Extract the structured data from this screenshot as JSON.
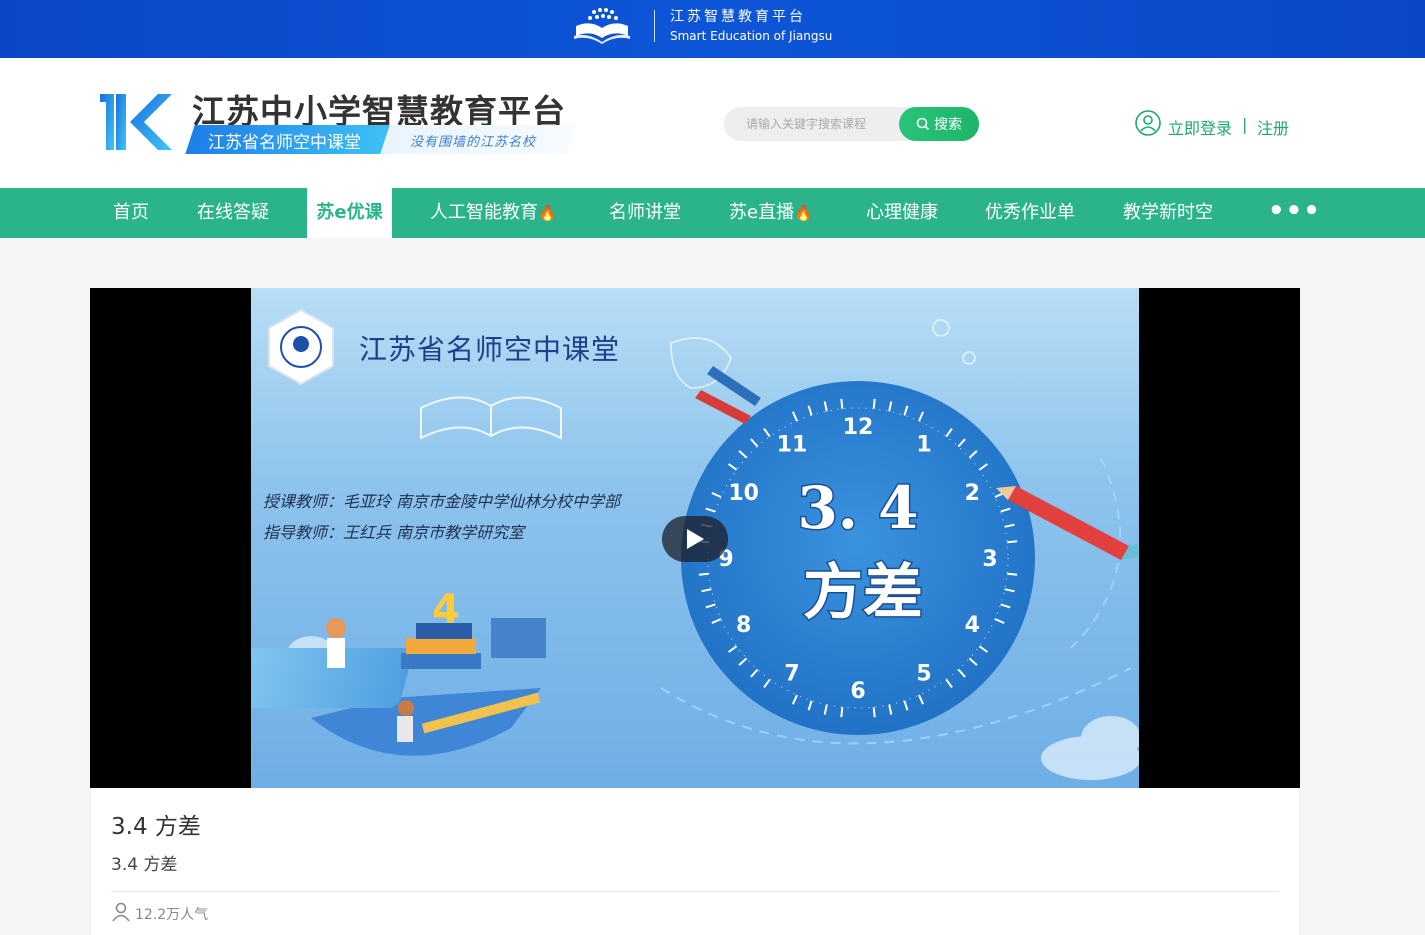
{
  "topbar": {
    "title_cn": "江苏智慧教育平台",
    "title_en": "Smart Education of Jiangsu"
  },
  "header": {
    "brand_title": "江苏中小学智慧教育平台",
    "brand_tag": "江苏省名师空中课堂",
    "brand_slogan": "没有围墙的江苏名校",
    "search_placeholder": "请输入关键字搜索课程",
    "search_button": "搜索",
    "login": "立即登录",
    "separator": "|",
    "register": "注册"
  },
  "nav": {
    "items": [
      {
        "label": "首页"
      },
      {
        "label": "在线答疑"
      },
      {
        "label": "苏e优课"
      },
      {
        "label": "人工智能教育"
      },
      {
        "label": "名师讲堂"
      },
      {
        "label": "苏e直播"
      },
      {
        "label": "心理健康"
      },
      {
        "label": "优秀作业单"
      },
      {
        "label": "教学新时空"
      }
    ],
    "more": "•••",
    "active_index": 2
  },
  "video": {
    "banner_title": "江苏省名师空中课堂",
    "teacher_line": "授课教师：毛亚玲  南京市金陵中学仙林分校中学部",
    "guide_line": "指导教师：王红兵  南京市教学研究室",
    "lesson_number": "3. 4",
    "lesson_name": "方差",
    "clock_numbers": [
      "12",
      "1",
      "2",
      "3",
      "4",
      "5",
      "6",
      "7",
      "8",
      "9",
      "10",
      "11"
    ]
  },
  "info": {
    "title": "3.4 方差",
    "subtitle": "3.4 方差",
    "popularity": "12.2万人气"
  },
  "colors": {
    "topbar": "#0d55d8",
    "nav": "#2bb38a",
    "accent_green": "#20a873"
  }
}
